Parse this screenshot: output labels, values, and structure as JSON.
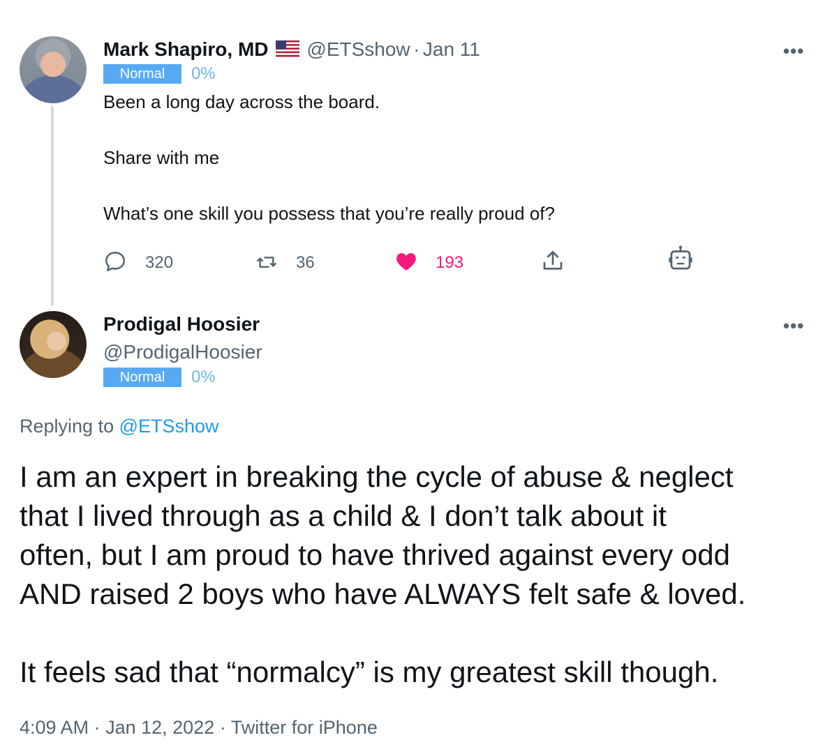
{
  "tweet1": {
    "name": "Mark Shapiro, MD",
    "flag_icon": "us-flag-icon",
    "handle": "@ETSshow",
    "separator": "·",
    "date": "Jan 11",
    "badge": "Normal",
    "percent": "0%",
    "text_line1": "Been a long day across the board.",
    "text_line2": "Share with me",
    "text_line3": "What’s one skill you possess that you’re really proud of?",
    "more": "•••",
    "actions": {
      "reply_count": "320",
      "retweet_count": "36",
      "like_count": "193",
      "like_color": "#f91880"
    }
  },
  "tweet2": {
    "name": "Prodigal Hoosier",
    "handle": "@ProdigalHoosier",
    "badge": "Normal",
    "percent": "0%",
    "more": "•••",
    "replying_prefix": "Replying to",
    "replying_handle": "@ETSshow",
    "body_line1": "I am an expert in breaking the cycle of abuse & neglect",
    "body_line2": "that I lived through as a child & I don’t talk about it",
    "body_line3": "often, but I am proud to have thrived against every odd",
    "body_line4": "AND raised 2 boys who have ALWAYS felt safe & loved.",
    "body_line5": "It feels sad that “normalcy” is my greatest skill though.",
    "time": "4:09 AM",
    "separator1": "·",
    "date": "Jan 12, 2022",
    "separator2": "·",
    "source": "Twitter for iPhone"
  },
  "colors": {
    "link": "#1d9bf0",
    "badge": "#58a9f3",
    "muted": "#536471"
  }
}
